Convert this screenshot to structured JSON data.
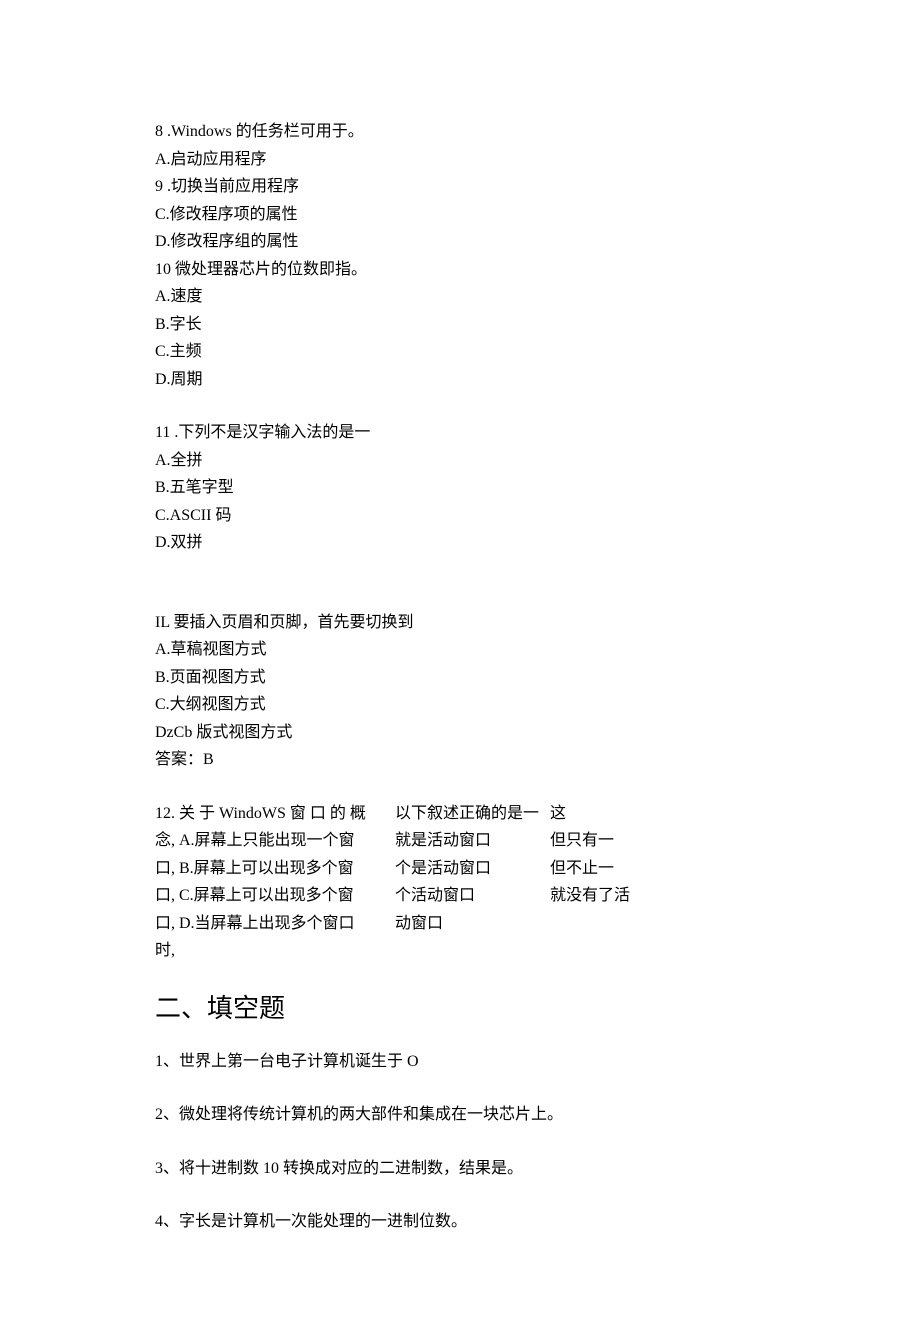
{
  "q8": {
    "num": "8",
    "sep": " .",
    "stem": "Windows 的任务栏可用于。",
    "a": "A.启动应用程序",
    "num2": "9",
    "sep2": " .",
    "b_alt": "切换当前应用程序",
    "c": "C.修改程序项的属性",
    "d": "D.修改程序组的属性"
  },
  "q10": {
    "num": "10",
    "sep": " ",
    "stem": "微处理器芯片的位数即指。",
    "a": "A.速度",
    "b": "B.字长",
    "c": "C.主频",
    "d": "D.周期"
  },
  "q11": {
    "num": "11",
    "sep": " .",
    "stem": "下列不是汉字输入法的是一",
    "a": "A.全拼",
    "b": "B.五笔字型",
    "c": "C.ASCII 码",
    "d": "D.双拼"
  },
  "qIL": {
    "stem": "IL 要插入页眉和页脚，首先要切换到",
    "a": "A.草稿视图方式",
    "b": "B.页面视图方式",
    "c": "C.大纲视图方式",
    "d": "DzCb 版式视图方式",
    "ans": "答案：B"
  },
  "q12": {
    "col1": {
      "l1": "12. 关 于 WindoWS 窗 口 的 概",
      "l2": "念, A.屏幕上只能出现一个窗",
      "l3": "口, B.屏幕上可以出现多个窗",
      "l4": "口, C.屏幕上可以出现多个窗",
      "l5": "口, D.当屏幕上出现多个窗口",
      "l6": "时,"
    },
    "col2": {
      "l1": "以下叙述正确的是一",
      "l2": "就是活动窗口",
      "l3": "个是活动窗口",
      "l4": "个活动窗口",
      "l5": "动窗口"
    },
    "col3": {
      "l1": "这",
      "l2": "但只有一",
      "l3": "但不止一",
      "l4": "就没有了活"
    }
  },
  "section2": {
    "title": "二、填空题",
    "f1": "1、世界上第一台电子计算机诞生于 O",
    "f2": "2、微处理将传统计算机的两大部件和集成在一块芯片上。",
    "f3": "3、将十进制数 10 转换成对应的二进制数，结果是。",
    "f4": "4、字长是计算机一次能处理的一进制位数。"
  }
}
